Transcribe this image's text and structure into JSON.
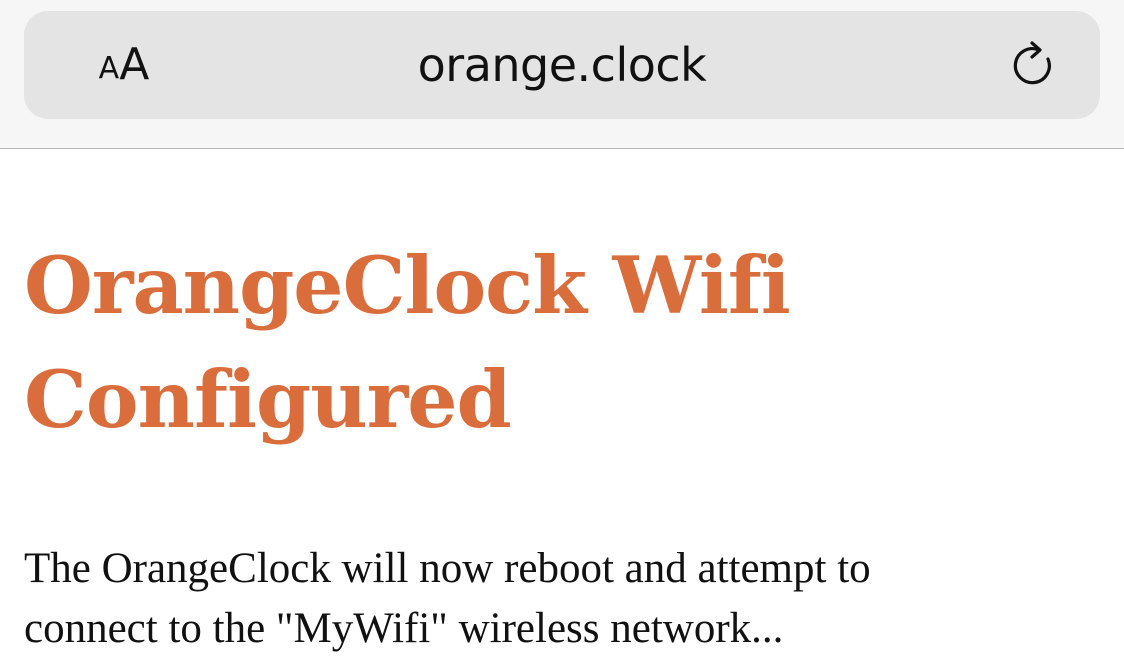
{
  "browser": {
    "text_size_label_small": "A",
    "text_size_label_large": "A",
    "url": "orange.clock",
    "reload_icon": "reload-icon"
  },
  "page": {
    "title": "OrangeClock Wifi Configured",
    "message": "The OrangeClock will now reboot and attempt to connect to the \"MyWifi\" wireless network..."
  },
  "colors": {
    "title": "#d96d3c",
    "address_bar": "#e4e4e4",
    "toolbar_background": "#f6f6f6"
  }
}
